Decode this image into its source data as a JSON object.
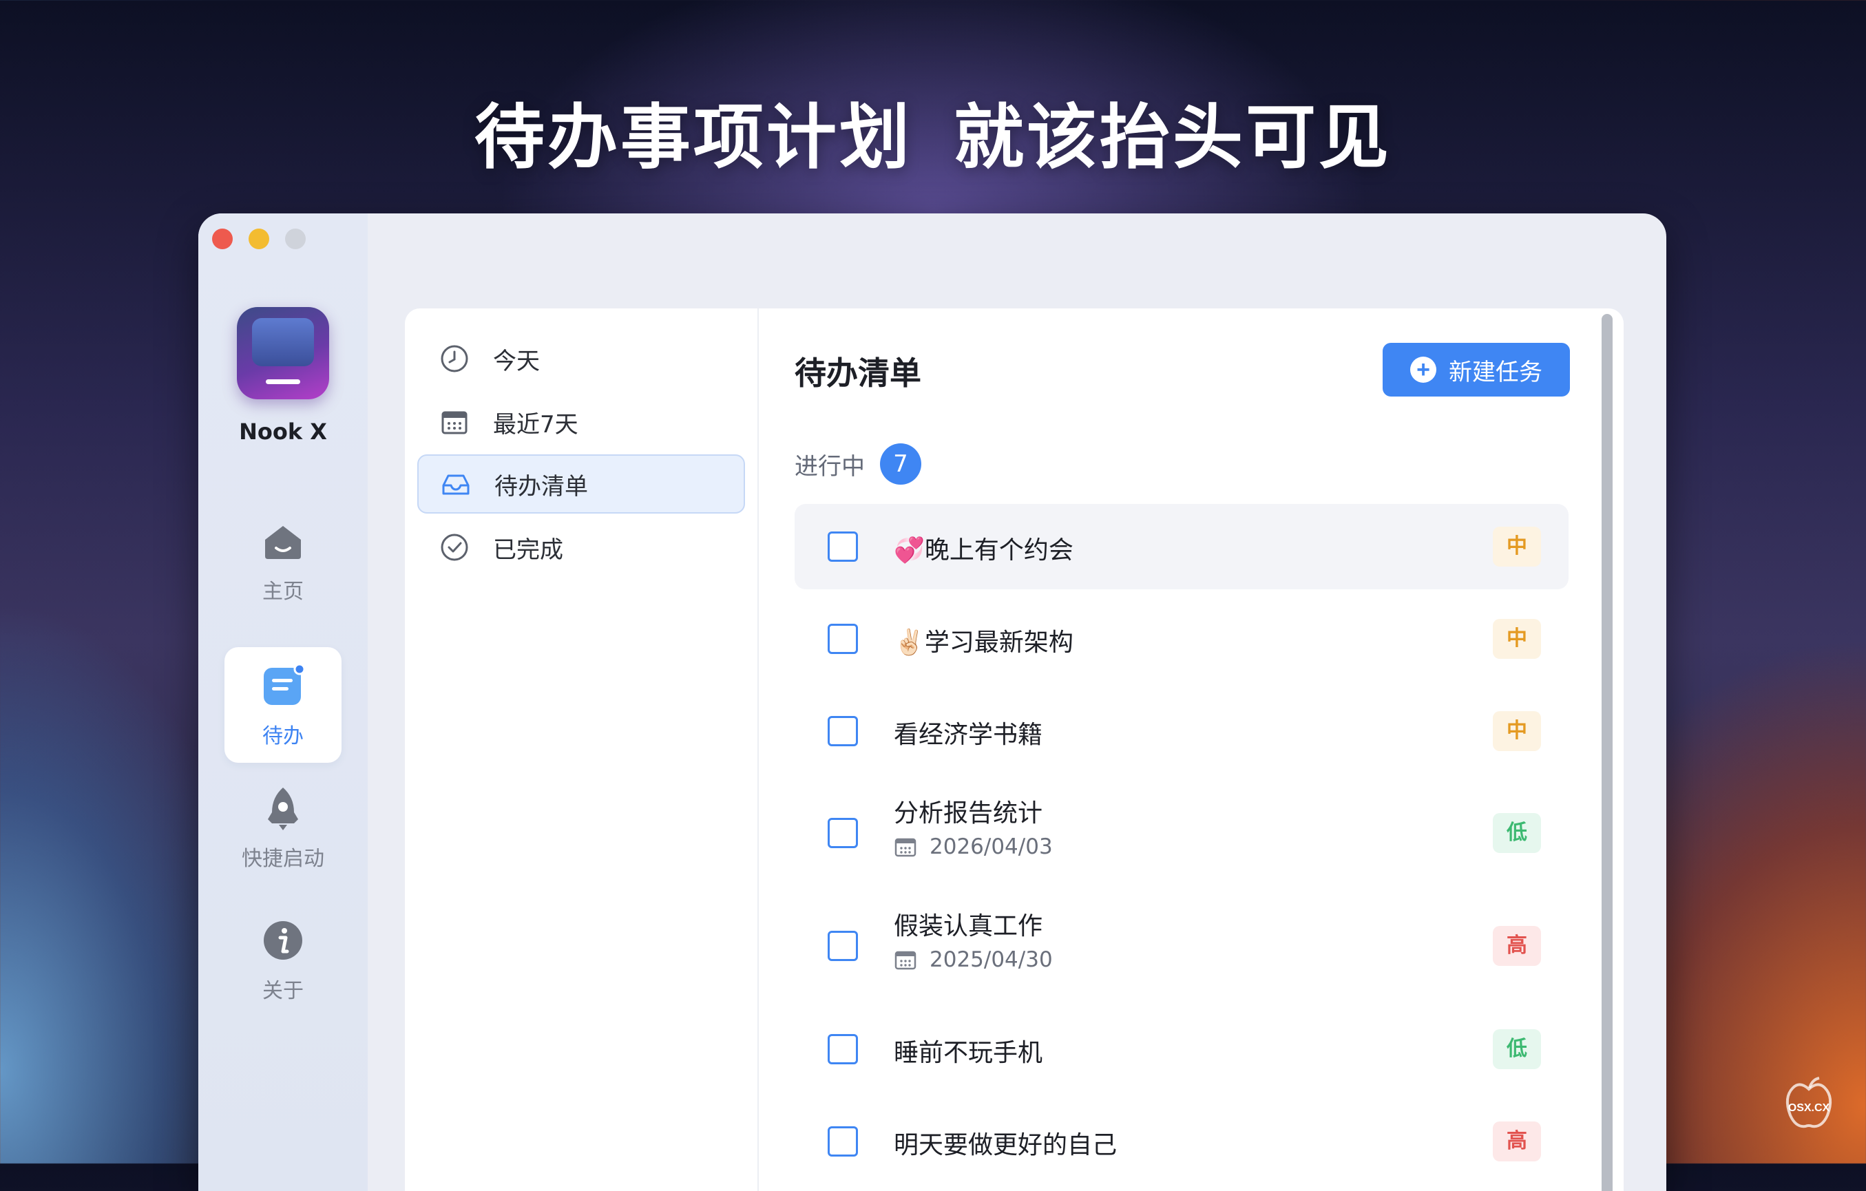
{
  "headline": {
    "part1": "待办事项计划",
    "part2": "就该抬头可见"
  },
  "window": {
    "app_name": "Nook X",
    "nav": [
      {
        "label": "主页",
        "icon": "home-icon"
      },
      {
        "label": "待办",
        "icon": "todo-icon"
      },
      {
        "label": "快捷启动",
        "icon": "rocket-icon"
      },
      {
        "label": "关于",
        "icon": "info-icon"
      }
    ],
    "active_nav": "待办"
  },
  "filters": [
    {
      "label": "今天",
      "icon": "clock-icon"
    },
    {
      "label": "最近7天",
      "icon": "calendar-icon"
    },
    {
      "label": "待办清单",
      "icon": "inbox-icon"
    },
    {
      "label": "已完成",
      "icon": "check-circle-icon"
    }
  ],
  "active_filter": "待办清单",
  "content": {
    "title": "待办清单",
    "new_button": "新建任务",
    "section_label": "进行中",
    "section_count": "7"
  },
  "tasks": [
    {
      "name": "💞晚上有个约会",
      "date": "",
      "priority": "中",
      "level": "mid"
    },
    {
      "name": "✌🏻学习最新架构",
      "date": "",
      "priority": "中",
      "level": "mid"
    },
    {
      "name": "看经济学书籍",
      "date": "",
      "priority": "中",
      "level": "mid"
    },
    {
      "name": "分析报告统计",
      "date": "2026/04/03",
      "priority": "低",
      "level": "low"
    },
    {
      "name": "假装认真工作",
      "date": "2025/04/30",
      "priority": "高",
      "level": "high"
    },
    {
      "name": "睡前不玩手机",
      "date": "",
      "priority": "低",
      "level": "low"
    },
    {
      "name": "明天要做更好的自己",
      "date": "",
      "priority": "高",
      "level": "high"
    }
  ],
  "colors": {
    "accent": "#3f86f3",
    "priority_mid": "#e49a22",
    "priority_low": "#3cb971",
    "priority_high": "#e2534f"
  },
  "watermark": "OSX.CX"
}
